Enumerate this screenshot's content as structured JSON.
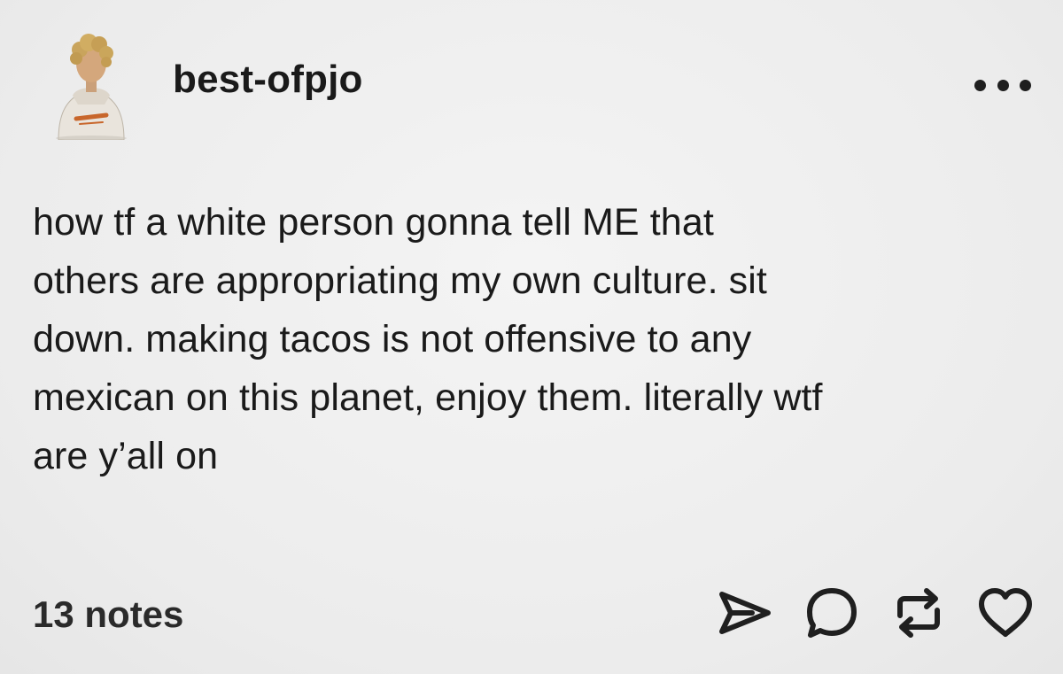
{
  "post": {
    "username": "best-ofpjo",
    "avatar_icon": "avatar-icon",
    "more_icon": "more-dots-icon",
    "body_lines": [
      "how tf a white person gonna tell ME that",
      "others are appropriating my own culture. sit",
      "down. making tacos is not offensive to any",
      "mexican on this planet, enjoy them. literally wtf",
      "are y’all on"
    ],
    "notes_label": "13 notes",
    "actions": [
      {
        "name": "share",
        "icon": "send-icon"
      },
      {
        "name": "reply",
        "icon": "comment-icon"
      },
      {
        "name": "reblog",
        "icon": "reblog-icon"
      },
      {
        "name": "like",
        "icon": "heart-icon"
      }
    ]
  },
  "colors": {
    "background": "#efefef",
    "text": "#1a1a1a",
    "icon": "#1f1f1f"
  }
}
